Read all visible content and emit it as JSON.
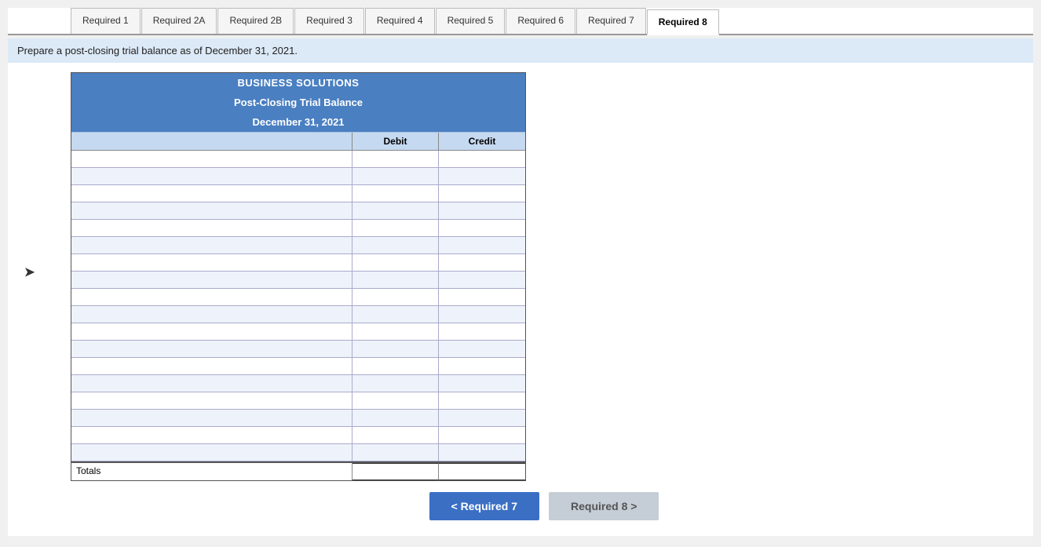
{
  "tabs": [
    {
      "id": "req1",
      "label": "Required 1",
      "active": false
    },
    {
      "id": "req2a",
      "label": "Required 2A",
      "active": false
    },
    {
      "id": "req2b",
      "label": "Required 2B",
      "active": false
    },
    {
      "id": "req3",
      "label": "Required 3",
      "active": false
    },
    {
      "id": "req4",
      "label": "Required 4",
      "active": false
    },
    {
      "id": "req5",
      "label": "Required 5",
      "active": false
    },
    {
      "id": "req6",
      "label": "Required 6",
      "active": false
    },
    {
      "id": "req7",
      "label": "Required 7",
      "active": false
    },
    {
      "id": "req8",
      "label": "Required 8",
      "active": true
    }
  ],
  "instruction": "Prepare a post-closing trial balance as of December 31, 2021.",
  "table": {
    "title1": "BUSINESS SOLUTIONS",
    "title2": "Post-Closing Trial Balance",
    "title3": "December 31, 2021",
    "col_debit": "Debit",
    "col_credit": "Credit",
    "rows_count": 18,
    "totals_label": "Totals"
  },
  "nav": {
    "prev_label": "< Required 7",
    "next_label": "Required 8 >"
  }
}
